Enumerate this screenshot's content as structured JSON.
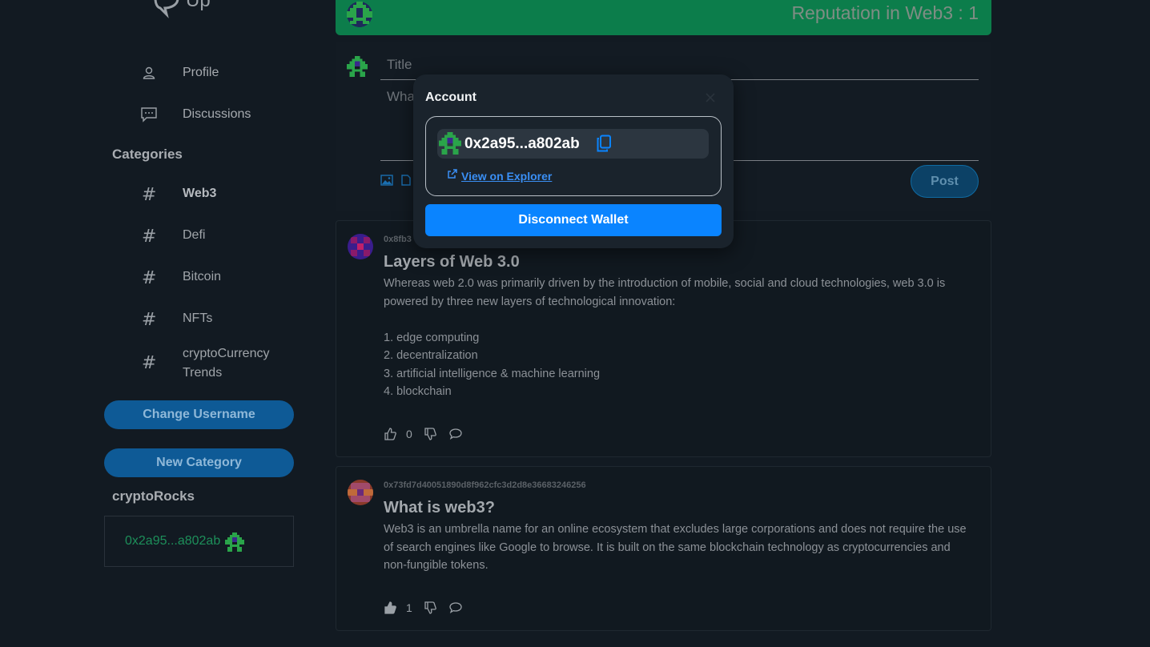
{
  "app": {
    "logo_text": "Up"
  },
  "sidebar": {
    "nav": [
      {
        "label": "Profile",
        "icon": "user-icon"
      },
      {
        "label": "Discussions",
        "icon": "chat-icon"
      }
    ],
    "categories_title": "Categories",
    "categories": [
      {
        "label": "Web3",
        "active": true
      },
      {
        "label": "Defi",
        "active": false
      },
      {
        "label": "Bitcoin",
        "active": false
      },
      {
        "label": "NFTs",
        "active": false
      },
      {
        "label": "cryptoCurrency Trends",
        "active": false
      }
    ],
    "change_username_label": "Change Username",
    "new_category_label": "New Category",
    "username": "cryptoRocks",
    "wallet_short": "0x2a95...a802ab"
  },
  "banner": {
    "text": "Reputation in Web3 : 1",
    "color": "#0c7d4b"
  },
  "composer": {
    "title_placeholder": "Title",
    "body_placeholder": "What's on your mind?",
    "post_label": "Post"
  },
  "posts": [
    {
      "author": "0x8fb3",
      "title": "Layers of Web 3.0",
      "body": "Whereas web 2.0 was primarily driven by the introduction of mobile, social and cloud technologies, web 3.0 is powered by three new layers of technological innovation:\n\n1. edge computing\n2. decentralization\n3. artificial intelligence & machine learning\n4. blockchain",
      "likes": "0",
      "liked": false
    },
    {
      "author": "0x73fd7d40051890d8f962cfc3d2d8e36683246256",
      "title": "What is web3?",
      "body": "Web3 is an umbrella name for an online ecosystem that excludes large corporations and does not require the use of search engines like Google to browse. It is built on the same blockchain technology as cryptocurrencies and non-fungible tokens.",
      "likes": "1",
      "liked": true
    }
  ],
  "modal": {
    "title": "Account",
    "address": "0x2a95...a802ab",
    "explorer_label": "View on Explorer",
    "disconnect_label": "Disconnect Wallet",
    "accent": "#0a84ff"
  }
}
